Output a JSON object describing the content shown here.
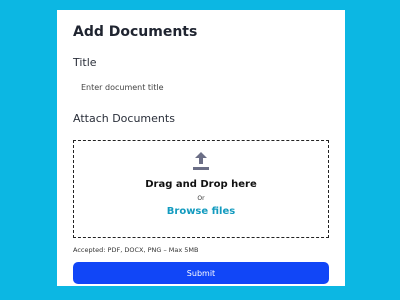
{
  "form": {
    "title": "Add Documents",
    "title_label": "Title",
    "title_placeholder": "Enter document title",
    "attach_label": "Attach Documents",
    "dropzone": {
      "icon": "upload-icon",
      "main_text": "Drag and Drop here",
      "or_text": "Or",
      "browse_text": "Browse files"
    },
    "accepted_text": "Accepted: PDF, DOCX, PNG – Max 5MB",
    "submit_label": "Submit"
  },
  "colors": {
    "background": "#0cb7e3",
    "card": "#ffffff",
    "accent": "#1146f7",
    "browse_link": "#139bbf",
    "icon": "#6b6e86"
  }
}
